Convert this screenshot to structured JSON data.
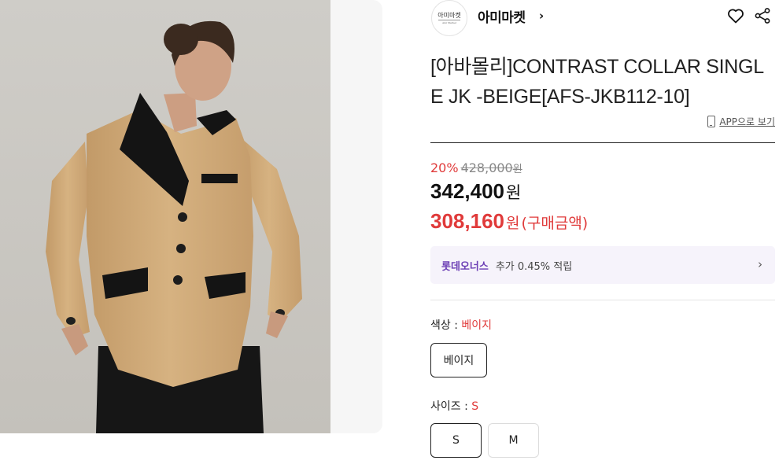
{
  "store": {
    "logo_text_main": "아미마켓",
    "logo_text_sub": "Ami Market",
    "name": "아미마켓",
    "chevron": "›",
    "icons": [
      "heart-icon",
      "share-icon"
    ]
  },
  "product": {
    "title": "[아바몰리]CONTRAST COLLAR SINGLE JK -BEIGE[AFS-JKB112-10]",
    "app_link": "APP으로 보기"
  },
  "price": {
    "discount_rate": "20%",
    "original_price": "428,000",
    "original_currency": "원",
    "sale_price": "342,400",
    "sale_currency": "원",
    "buy_price": "308,160",
    "buy_currency": "원",
    "buy_note": "(구매금액)"
  },
  "points": {
    "brand": "롯데오너스",
    "text": "추가 0.45% 적립",
    "chevron": "›"
  },
  "options": {
    "color": {
      "label": "색상 : ",
      "selected": "베이지",
      "values": [
        "베이지"
      ]
    },
    "size": {
      "label": "사이즈 : ",
      "selected": "S",
      "values": [
        "S",
        "M"
      ]
    }
  },
  "colors": {
    "accent_red": "#e03a3a",
    "points_purple": "#6c3fb5",
    "points_bg": "#f6f3fb",
    "jacket_beige": "#d2ac7c"
  }
}
